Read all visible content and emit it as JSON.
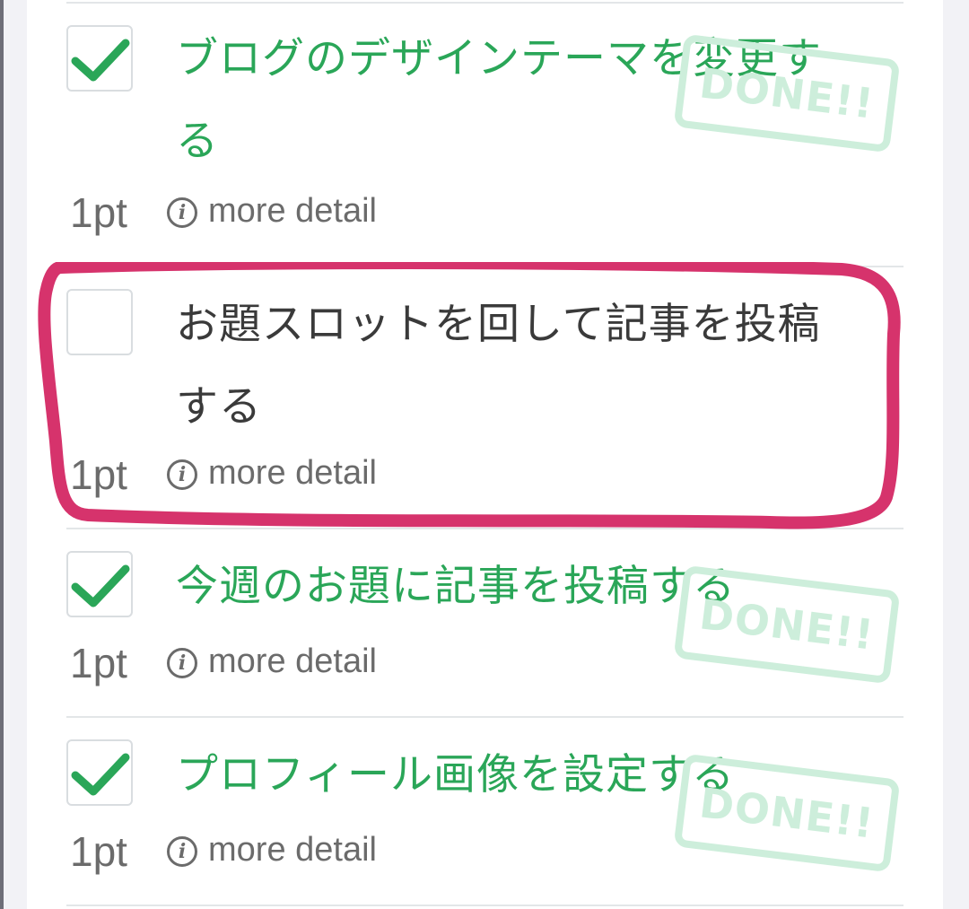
{
  "colors": {
    "done_green": "#2aa658",
    "stamp_green": "#cdeedb",
    "highlight_pink": "#d6336c",
    "text_dark": "#3a3a3a",
    "text_gray": "#6b6b6b"
  },
  "tasks": [
    {
      "title_line1": "ブログのデザインテーマを変更す",
      "title_line2": "る",
      "points": "1pt",
      "detail_label": "more detail",
      "detail_icon": "info-icon",
      "checked": true,
      "stamp": "DONE!!"
    },
    {
      "title_line1": "お題スロットを回して記事を投稿",
      "title_line2": "する",
      "points": "1pt",
      "detail_label": "more detail",
      "detail_icon": "info-icon",
      "checked": false,
      "highlighted": true
    },
    {
      "title_line1": "今週のお題に記事を投稿する",
      "points": "1pt",
      "detail_label": "more detail",
      "detail_icon": "info-icon",
      "checked": true,
      "stamp": "DONE!!"
    },
    {
      "title_line1": "プロフィール画像を設定する",
      "points": "1pt",
      "detail_label": "more detail",
      "detail_icon": "info-icon",
      "checked": true,
      "stamp": "DONE!!"
    }
  ]
}
